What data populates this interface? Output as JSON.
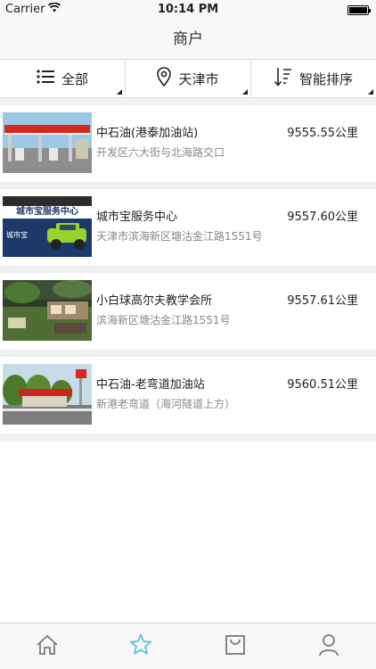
{
  "status_bar": {
    "carrier": "Carrier",
    "time": "10:14 PM"
  },
  "nav": {
    "title": "商户"
  },
  "filters": [
    {
      "label": "全部",
      "icon": "list-icon"
    },
    {
      "label": "天津市",
      "icon": "location-pin-icon"
    },
    {
      "label": "智能排序",
      "icon": "sort-icon"
    }
  ],
  "merchants": [
    {
      "name": "中石油(港泰加油站)",
      "distance": "9555.55公里",
      "address": "开发区六大街与北海路交口"
    },
    {
      "name": "城市宝服务中心",
      "distance": "9557.60公里",
      "address": "天津市滨海新区塘沽金江路1551号",
      "thumb_text": "城市宝服务中心",
      "thumb_brand": "城市宝"
    },
    {
      "name": "小白球高尔夫教学会所",
      "distance": "9557.61公里",
      "address": "滨海新区塘沽金江路1551号"
    },
    {
      "name": "中石油-老弯道加油站",
      "distance": "9560.51公里",
      "address": "新港老弯道（海河隧道上方）"
    }
  ],
  "tabs": [
    {
      "icon": "home-icon",
      "active": false
    },
    {
      "icon": "star-icon",
      "active": true
    },
    {
      "icon": "shopping-bag-icon",
      "active": false
    },
    {
      "icon": "user-icon",
      "active": false
    }
  ],
  "colors": {
    "accent": "#5bc0de",
    "tab_inactive": "#7a7a7a",
    "address_text": "#888888",
    "separator": "#f0f0f0"
  }
}
